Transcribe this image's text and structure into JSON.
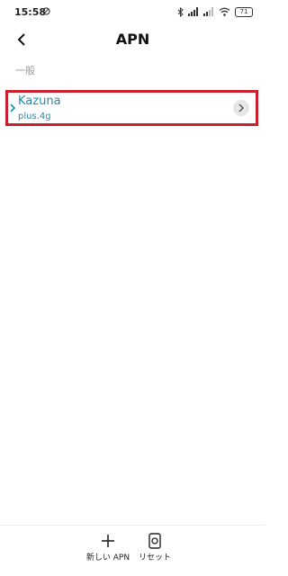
{
  "status_bar": {
    "time": "15:58",
    "battery": "71",
    "icons": [
      "no-disturb-icon",
      "bluetooth-icon",
      "signal-icon",
      "signal-icon",
      "wifi-icon",
      "battery-icon"
    ]
  },
  "header": {
    "title": "APN",
    "back_icon": "chevron-left-icon"
  },
  "section": {
    "label": "一般"
  },
  "apn_list": [
    {
      "name": "Kazuna",
      "apn": "plus.4g",
      "selected": true
    }
  ],
  "bottom_bar": {
    "new_apn_label": "新しい APN",
    "reset_label": "リセット"
  },
  "colors": {
    "accent": "#1a8fb5",
    "highlight_border": "#c8202f",
    "background": "#ffffff"
  }
}
